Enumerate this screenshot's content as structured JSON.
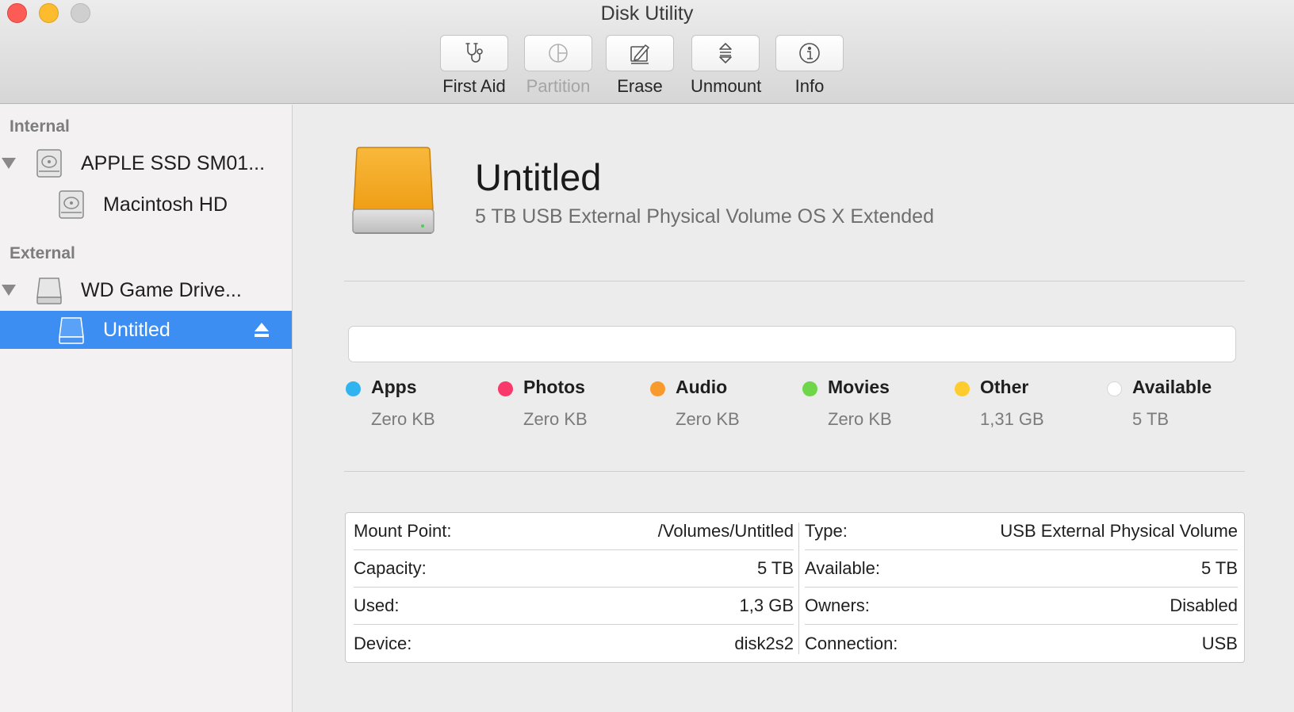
{
  "window": {
    "title": "Disk Utility"
  },
  "toolbar": {
    "items": [
      {
        "label": "First Aid",
        "icon": "stethoscope-icon",
        "enabled": true
      },
      {
        "label": "Partition",
        "icon": "partition-icon",
        "enabled": false
      },
      {
        "label": "Erase",
        "icon": "erase-icon",
        "enabled": true
      },
      {
        "label": "Unmount",
        "icon": "unmount-icon",
        "enabled": true
      },
      {
        "label": "Info",
        "icon": "info-icon",
        "enabled": true
      }
    ]
  },
  "sidebar": {
    "internal_header": "Internal",
    "external_header": "External",
    "items": [
      {
        "label": "APPLE SSD SM01...",
        "icon": "internal-disk-icon",
        "expanded": true
      },
      {
        "label": "Macintosh HD",
        "icon": "internal-volume-icon"
      },
      {
        "label": "WD Game Drive...",
        "icon": "external-disk-icon",
        "expanded": true
      },
      {
        "label": "Untitled",
        "icon": "external-volume-icon",
        "selected": true,
        "eject_icon": "eject-icon"
      }
    ]
  },
  "volume": {
    "name": "Untitled",
    "description": "5 TB USB External Physical Volume OS X Extended",
    "icon": "external-drive-icon",
    "icon_color": "#f5a623"
  },
  "usage": {
    "categories": [
      {
        "name": "Apps",
        "size": "Zero KB",
        "color": "#2fb4f0"
      },
      {
        "name": "Photos",
        "size": "Zero KB",
        "color": "#f8396a"
      },
      {
        "name": "Audio",
        "size": "Zero KB",
        "color": "#f99a2c"
      },
      {
        "name": "Movies",
        "size": "Zero KB",
        "color": "#6fd649"
      },
      {
        "name": "Other",
        "size": "1,31 GB",
        "color": "#fecc2f"
      },
      {
        "name": "Available",
        "size": "5 TB",
        "color": "#ffffff"
      }
    ]
  },
  "info": {
    "left": [
      {
        "label": "Mount Point:",
        "value": "/Volumes/Untitled"
      },
      {
        "label": "Capacity:",
        "value": "5 TB"
      },
      {
        "label": "Used:",
        "value": "1,3 GB"
      },
      {
        "label": "Device:",
        "value": "disk2s2"
      }
    ],
    "right": [
      {
        "label": "Type:",
        "value": "USB External Physical Volume"
      },
      {
        "label": "Available:",
        "value": "5 TB"
      },
      {
        "label": "Owners:",
        "value": "Disabled"
      },
      {
        "label": "Connection:",
        "value": "USB"
      }
    ]
  },
  "colors": {
    "selection": "#3c8ef3",
    "close": "#fd5c56",
    "minimize": "#fdbc2e",
    "zoom": "#cfcfcf"
  }
}
